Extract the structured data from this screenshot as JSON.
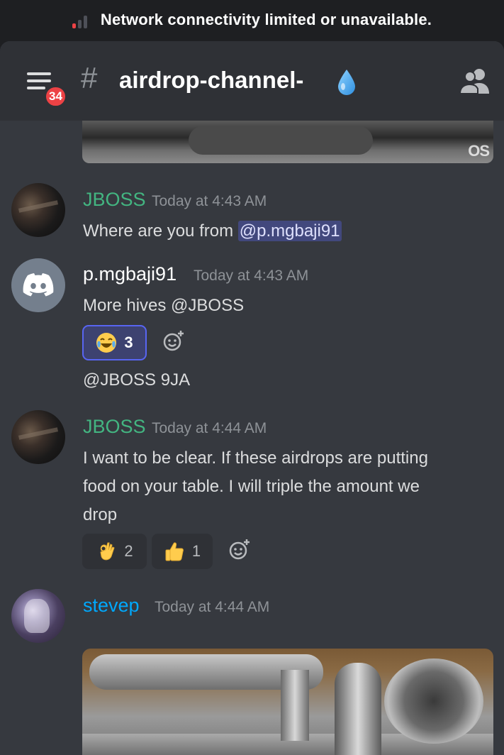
{
  "status": {
    "text": "Network connectivity limited or unavailable."
  },
  "header": {
    "badge": "34",
    "hash": "#",
    "channel": "airdrop-channel-"
  },
  "gif_top": {
    "watermark": "OS"
  },
  "messages": [
    {
      "user": "JBOSS",
      "user_color": "#43b581",
      "time": "Today at 4:43 AM",
      "text_prefix": "Where are you from ",
      "mention": "@p.mgbaji91"
    },
    {
      "user": "p.mgbaji91",
      "user_color": "#ffffff",
      "time": "Today at 4:43 AM",
      "text": "More hives @JBOSS",
      "reaction": {
        "emoji": "joy-emoji",
        "count": "3"
      },
      "followup": "@JBOSS 9JA"
    },
    {
      "user": "JBOSS",
      "user_color": "#43b581",
      "time": "Today at 4:44 AM",
      "lines": [
        "I want to be clear. If these airdrops are putting",
        "food on your table. I will triple the amount we",
        "drop"
      ],
      "reactions": [
        {
          "emoji": "ok-hand-emoji",
          "count": "2"
        },
        {
          "emoji": "thumbs-up-emoji",
          "count": "1"
        }
      ]
    },
    {
      "user": "stevep",
      "user_color": "#00a8fc",
      "time": "Today at 4:44 AM"
    }
  ],
  "colors": {
    "background": "#36393f",
    "header": "#2f3136",
    "accent": "#5865f2",
    "danger": "#ed4245"
  }
}
